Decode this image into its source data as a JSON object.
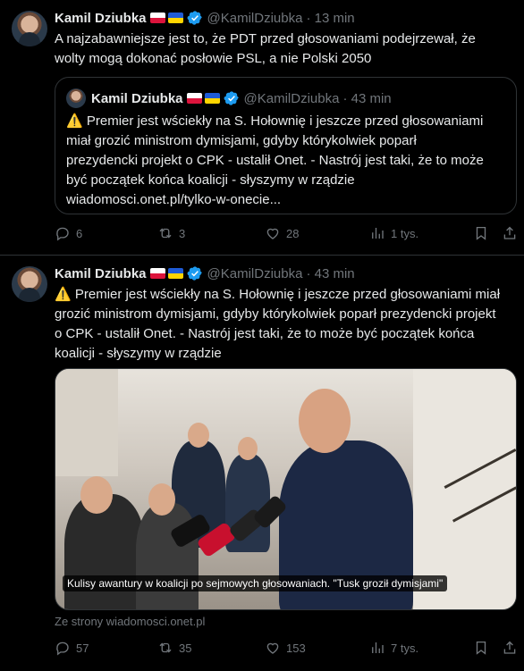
{
  "tweets": [
    {
      "name": "Kamil Dziubka",
      "handle": "@KamilDziubka",
      "time": "· 13 min",
      "text": "A najzabawniejsze jest to, że PDT przed głosowaniami podejrzewał, że\nwolty mogą dokonać posłowie PSL, a nie Polski 2050",
      "quote": {
        "name": "Kamil Dziubka",
        "handle": "@KamilDziubka",
        "time": "· 43 min",
        "emoji": "⚠️",
        "text": " Premier jest wściekły na S. Hołownię i jeszcze przed głosowaniami\nmiał grozić ministrom dymisjami, gdyby którykolwiek poparł\nprezydencki projekt o CPK - ustalił Onet. - Nastrój jest taki, że to może\nbyć początek końca koalicji - słyszymy w rządzie\nwiadomosci.onet.pl/tylko-w-onecie..."
      },
      "stats": {
        "replies": "6",
        "reposts": "3",
        "likes": "28",
        "views": "1 tys."
      }
    },
    {
      "name": "Kamil Dziubka",
      "handle": "@KamilDziubka",
      "time": "· 43 min",
      "emoji": "⚠️",
      "text": " Premier jest wściekły na S. Hołownię i jeszcze przed głosowaniami miał\ngrozić ministrom dymisjami, gdyby którykolwiek poparł prezydencki projekt\no CPK - ustalił Onet. - Nastrój jest taki, że to może być początek końca\nkoalicji - słyszymy w rządzie",
      "media_caption": "Kulisy awantury w koalicji po sejmowych głosowaniach. \"Tusk groził dymisjami\"",
      "source": "Ze strony wiadomosci.onet.pl",
      "stats": {
        "replies": "57",
        "reposts": "35",
        "likes": "153",
        "views": "7 tys."
      }
    }
  ],
  "colors": {
    "background": "#000000",
    "text": "#e7e9ea",
    "muted": "#71767b",
    "border": "#2f3336",
    "verified": "#1d9bf0"
  },
  "icons": [
    "reply-icon",
    "repost-icon",
    "like-icon",
    "views-icon",
    "bookmark-icon",
    "share-icon",
    "verified-icon",
    "flag-pl-icon",
    "flag-ua-icon"
  ]
}
